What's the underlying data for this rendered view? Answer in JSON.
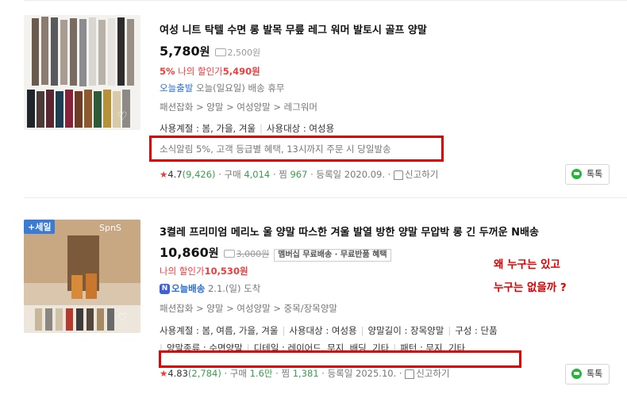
{
  "products": [
    {
      "title": "여성 니트 탁텔 수면 롱 발목 무릎 레그 워머 발토시 골프 양말",
      "price": "5,780",
      "currency": "원",
      "delivery_fee": "2,500원",
      "discount_pct": "5%",
      "discount_label": "나의 할인가",
      "discount_price": "5,490원",
      "delivery_brand": "오늘출발",
      "delivery_note": "오늘(일요일) 배송 휴무",
      "category": "패션잡화 > 양말 > 여성양말 > 레그워머",
      "attrs": [
        "사용계절 : 봄, 가을, 겨울",
        "사용대상 : 여성용"
      ],
      "promo": "소식알림 5%, 고객 등급별 혜택, 13시까지 주문 시 당일발송",
      "rating": "4.7",
      "review_count": "(9,426)",
      "purchase_label": "구매",
      "purchase_count": "4,014",
      "zzim_label": "찜",
      "zzim_count": "967",
      "registered": "등록일 2020.09.",
      "report": "신고하기",
      "talk": "톡톡"
    },
    {
      "badge": "+세일",
      "brand_mark": "SpnS",
      "title": "3켤레 프리미엄 메리노 울 양말 따스한 겨울 발열 방한 양말 무압박 롱 긴 두꺼운 N배송",
      "price": "10,860",
      "currency": "원",
      "delivery_fee_strike": "3,000원",
      "tag": "멤버십 무료배송 · 무료반품 혜택",
      "discount_label": "나의 할인가",
      "discount_price": "10,530원",
      "delivery_brand_badge": "N",
      "delivery_brand": "오늘배송",
      "delivery_note": "2.1.(일) 도착",
      "category": "패션잡화 > 양말 > 여성양말 > 중목/장목양말",
      "attrs": [
        "사용계절 : 봄, 여름, 가을, 겨울",
        "사용대상 : 여성용",
        "양말길이 : 장목양말",
        "구성 : 단품"
      ],
      "attrs2": [
        "양말종류 : 수면양말",
        "디테일 : 레이어드, 무지, 배딩, 기타",
        "패턴 : 무지, 기타"
      ],
      "rating": "4.83",
      "review_count": "(2,784)",
      "purchase_label": "구매",
      "purchase_count": "1.6만",
      "zzim_label": "찜",
      "zzim_count": "1,381",
      "registered": "등록일 2025.10.",
      "report": "신고하기",
      "talk": "톡톡"
    }
  ],
  "annotation": {
    "line1": "왜 누구는 있고",
    "line2": "누구는 없을까 ?"
  },
  "colors": {
    "accent_red": "#f13c3c",
    "annotation_red": "#e00000",
    "link_blue": "#2b6ed4",
    "count_green": "#3a9e4e"
  }
}
